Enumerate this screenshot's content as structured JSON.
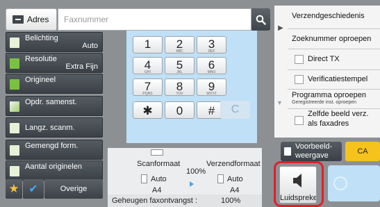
{
  "address": {
    "label": "Adres"
  },
  "fax_input": {
    "placeholder": "Faxnummer",
    "value": ""
  },
  "left_menu": {
    "belichting": {
      "label": "Belichting",
      "value": "Auto"
    },
    "resolutie": {
      "label": "Resolutie",
      "value": "Extra Fijn"
    },
    "origineel": {
      "label": "Origineel"
    },
    "opdr_samenst": {
      "label": "Opdr. samenst."
    },
    "langz_scanm": {
      "label": "Langz. scanm."
    },
    "gemengd_form": {
      "label": "Gemengd form."
    },
    "aantal_originelen": {
      "label": "Aantal originelen"
    },
    "overige": {
      "label": "Overige"
    }
  },
  "keypad": {
    "keys": [
      {
        "digit": "1",
        "sub": ""
      },
      {
        "digit": "2",
        "sub": "ABC"
      },
      {
        "digit": "3",
        "sub": "DEF"
      },
      {
        "digit": "4",
        "sub": "GHI"
      },
      {
        "digit": "5",
        "sub": "JKL"
      },
      {
        "digit": "6",
        "sub": "MNO"
      },
      {
        "digit": "7",
        "sub": "PQRS"
      },
      {
        "digit": "8",
        "sub": "TUV"
      },
      {
        "digit": "9",
        "sub": "WXYZ"
      },
      {
        "digit": "✱",
        "sub": ""
      },
      {
        "digit": "0",
        "sub": ""
      },
      {
        "digit": "#",
        "sub": ""
      }
    ],
    "clear": "C"
  },
  "scan_format": {
    "scan_label": "Scanformaat",
    "send_label": "Verzendformaat",
    "ratio": "100%",
    "scan_value": "Auto",
    "scan_size": "A4",
    "send_value": "Auto",
    "send_size": "A4"
  },
  "memory": {
    "label": "Geheugen faxontvangst :",
    "value": "100%"
  },
  "right_panel": {
    "verzendgeschiedenis": "Verzendgeschiedenis",
    "zoeknummer": "Zoeknummer oproepen",
    "direct_tx": "Direct TX",
    "verificatiestempel": "Verificatiestempel",
    "programma_oproepen": "Programma oproepen",
    "programma_sub": "Geregistreerde inst. oproepen",
    "zelfde_beeld_1": "Zelfde beeld verz.",
    "zelfde_beeld_2": "als faxadres"
  },
  "preview": {
    "line1": "Voorbeeld-",
    "line2": "weergave"
  },
  "ca_label": "CA",
  "speaker_label": "Luidspreker",
  "colors": {
    "accent_blue": "#bfe0f6",
    "highlight_red": "#e01f2b",
    "ca_yellow": "#f6c31c",
    "side_dark": "#3b4147"
  }
}
